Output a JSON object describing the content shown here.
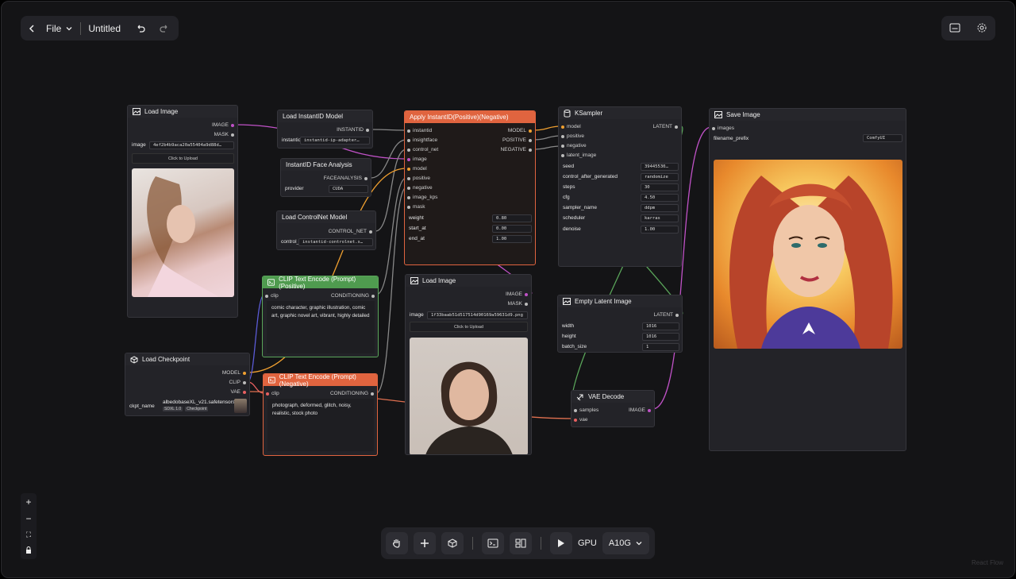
{
  "topbar": {
    "file_label": "File",
    "title": "Untitled"
  },
  "icons": {
    "back": "chevron-left-icon",
    "undo": "undo-icon",
    "redo": "redo-icon",
    "panel": "panel-icon",
    "settings": "gear-icon"
  },
  "nodes": {
    "load_image_1": {
      "title": "Load Image",
      "out_image": "IMAGE",
      "out_mask": "MASK",
      "image_label": "image",
      "image_value": "4ef2b4b9aca20a55404a9d88d…",
      "upload": "Click to Upload"
    },
    "load_instantid": {
      "title": "Load InstantID Model",
      "out": "INSTANTID",
      "field_label": "instantid",
      "field_value": "instantid-ip-adapter…"
    },
    "face_analysis": {
      "title": "InstantID Face Analysis",
      "out": "FACEANALYSIS",
      "field_label": "provider",
      "field_value": "CUDA"
    },
    "load_controlnet": {
      "title": "Load ControlNet Model",
      "out": "CONTROL_NET",
      "field_label": "control_",
      "field_value": "instantid-controlnet.s…"
    },
    "apply_instantid": {
      "title": "Apply InstantID(Positive)(Negative)",
      "inputs": [
        "instantid",
        "insightface",
        "control_net",
        "image",
        "model",
        "positive",
        "negative",
        "image_kps",
        "mask"
      ],
      "outputs": [
        "MODEL",
        "POSITIVE",
        "NEGATIVE"
      ],
      "weight_label": "weight",
      "weight": "0.80",
      "start_label": "start_at",
      "start": "0.00",
      "end_label": "end_at",
      "end": "1.00"
    },
    "ksampler": {
      "title": "KSampler",
      "inputs": [
        "model",
        "positive",
        "negative",
        "latent_image"
      ],
      "out": "LATENT",
      "seed_label": "seed",
      "seed": "39445530…",
      "control_label": "control_after_generated",
      "control": "randomize",
      "steps_label": "steps",
      "steps": "30",
      "cfg_label": "cfg",
      "cfg": "4.50",
      "sampler_label": "sampler_name",
      "sampler": "ddpm",
      "scheduler_label": "scheduler",
      "scheduler": "karras",
      "denoise_label": "denoise",
      "denoise": "1.00"
    },
    "save_image": {
      "title": "Save Image",
      "in": "images",
      "prefix_label": "filename_prefix",
      "prefix": "ComfyUI"
    },
    "clip_pos": {
      "title": "CLIP Text Encode (Prompt)(Positive)",
      "in": "clip",
      "out": "CONDITIONING",
      "text": "comic character, graphic illustration, comic art, graphic novel art, vibrant, highly detailed"
    },
    "clip_neg": {
      "title": "CLIP Text Encode (Prompt)(Negative)",
      "in": "clip",
      "out": "CONDITIONING",
      "text": "photograph, deformed, glitch, noisy, realistic, stock photo"
    },
    "load_checkpoint": {
      "title": "Load Checkpoint",
      "out_model": "MODEL",
      "out_clip": "CLIP",
      "out_vae": "VAE",
      "field_label": "ckpt_name",
      "ckpt": "albedobaseXL_v21.safetensors",
      "tag1": "SDXL 1.0",
      "tag2": "Checkpoint"
    },
    "load_image_2": {
      "title": "Load Image",
      "out_image": "IMAGE",
      "out_mask": "MASK",
      "image_label": "image",
      "image_value": "1f33baab51d517514d90169a59631d9.png",
      "upload": "Click to Upload"
    },
    "empty_latent": {
      "title": "Empty Latent Image",
      "out": "LATENT",
      "width_label": "width",
      "width": "1016",
      "height_label": "height",
      "height": "1016",
      "batch_label": "batch_size",
      "batch": "1"
    },
    "vae_decode": {
      "title": "VAE Decode",
      "in_samples": "samples",
      "in_vae": "vae",
      "out": "IMAGE"
    }
  },
  "bottombar": {
    "gpu_label": "GPU",
    "gpu_value": "A10G"
  },
  "watermark": "React Flow",
  "colors": {
    "orange": "#e0643f",
    "green": "#4f9b4f",
    "pink": "#c052c7",
    "canvas": "#141416"
  }
}
